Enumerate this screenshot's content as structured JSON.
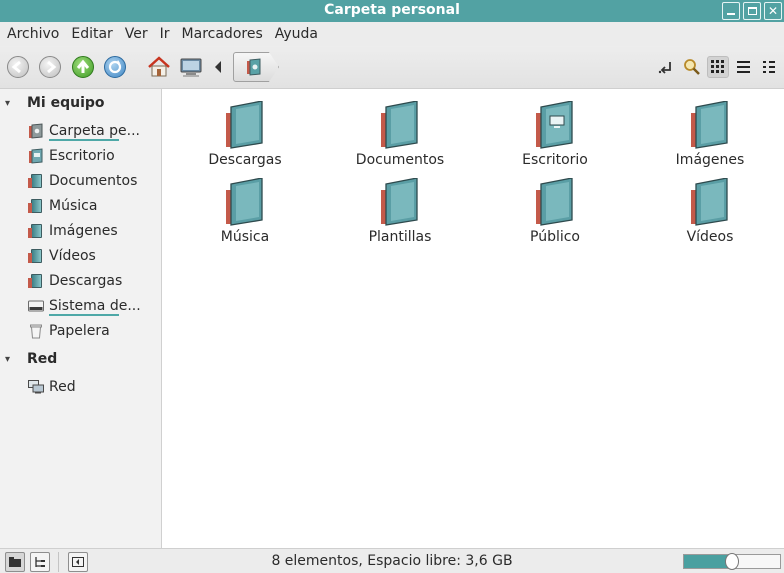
{
  "window": {
    "title": "Carpeta personal"
  },
  "menu": [
    "Archivo",
    "Editar",
    "Ver",
    "Ir",
    "Marcadores",
    "Ayuda"
  ],
  "toolbar": {
    "icons": [
      "back-icon",
      "forward-icon",
      "up-icon",
      "reload-icon",
      "home-icon",
      "computer-icon",
      "path-left-arrow-icon",
      "home-folder-icon",
      "toggle-location-icon",
      "search-icon",
      "icon-view-icon",
      "list-view-icon",
      "compact-view-icon"
    ]
  },
  "sidebar": {
    "sections": [
      {
        "title": "Mi equipo",
        "items": [
          {
            "label": "Carpeta pe...",
            "icon": "home-folder-icon"
          },
          {
            "label": "Escritorio",
            "icon": "desktop-folder-icon"
          },
          {
            "label": "Documentos",
            "icon": "folder-icon"
          },
          {
            "label": "Música",
            "icon": "folder-icon"
          },
          {
            "label": "Imágenes",
            "icon": "folder-icon"
          },
          {
            "label": "Vídeos",
            "icon": "folder-icon"
          },
          {
            "label": "Descargas",
            "icon": "folder-icon"
          },
          {
            "label": "Sistema de...",
            "icon": "drive-icon"
          },
          {
            "label": "Papelera",
            "icon": "trash-icon"
          }
        ]
      },
      {
        "title": "Red",
        "items": [
          {
            "label": "Red",
            "icon": "network-icon"
          }
        ]
      }
    ]
  },
  "files": [
    {
      "name": "Descargas",
      "icon": "folder-icon"
    },
    {
      "name": "Documentos",
      "icon": "folder-icon"
    },
    {
      "name": "Escritorio",
      "icon": "desktop-folder-icon"
    },
    {
      "name": "Imágenes",
      "icon": "folder-icon"
    },
    {
      "name": "Música",
      "icon": "folder-icon"
    },
    {
      "name": "Plantillas",
      "icon": "folder-icon"
    },
    {
      "name": "Público",
      "icon": "folder-icon"
    },
    {
      "name": "Vídeos",
      "icon": "folder-icon"
    }
  ],
  "status": {
    "text": "8 elementos, Espacio libre: 3,6 GB",
    "zoom_level": 0.5
  },
  "colors": {
    "accent": "#52a2a3",
    "folder": "#4d9aa0",
    "folder_spine": "#c45a4a"
  }
}
